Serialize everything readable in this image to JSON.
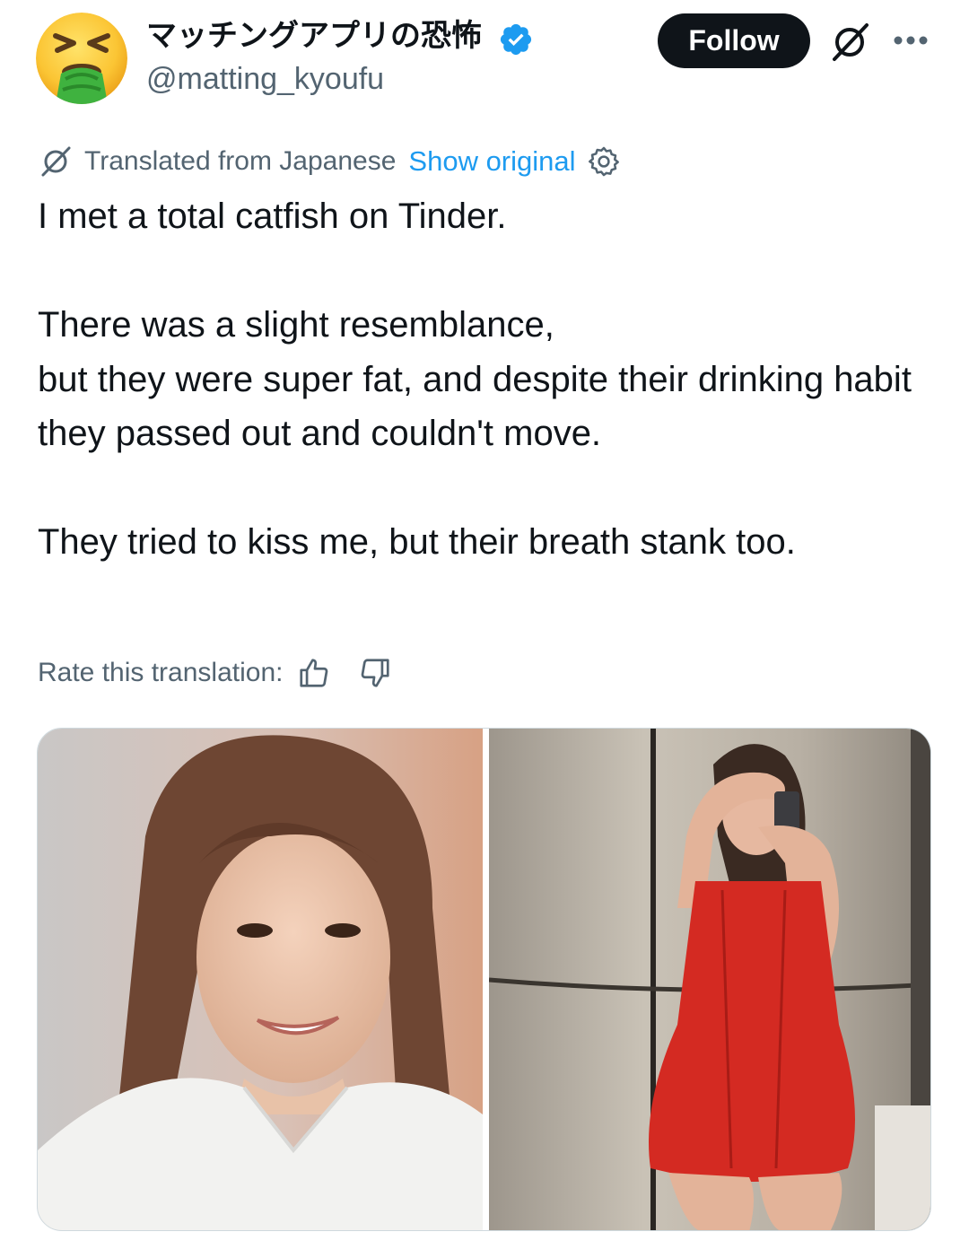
{
  "author": {
    "display_name": "マッチングアプリの恐怖",
    "handle": "@matting_kyoufu",
    "avatar": "nauseated-face-emoji",
    "verified": true
  },
  "actions": {
    "follow_label": "Follow",
    "grok_icon": "grok-icon",
    "more_icon": "more-dots-icon"
  },
  "translation": {
    "label": "Translated from Japanese",
    "show_original": "Show original",
    "settings_icon": "gear-icon"
  },
  "tweet": {
    "text": "I met a total catfish on Tinder.\n\nThere was a slight resemblance,\nbut they were super fat, and despite their drinking habit\nthey passed out and couldn't move.\n\nThey tried to kiss me, but their breath stank too."
  },
  "rating": {
    "label": "Rate this translation:",
    "up_icon": "thumbs-up-icon",
    "down_icon": "thumbs-down-icon"
  },
  "media": {
    "images": [
      {
        "name": "photo-smiling-woman-white-shirt"
      },
      {
        "name": "photo-woman-red-dress-mirror-selfie"
      }
    ]
  },
  "colors": {
    "accent": "#1d9bf0",
    "text": "#0f1419",
    "secondary": "#536471",
    "follow_bg": "#0f1419",
    "dress_red": "#d42a22"
  }
}
